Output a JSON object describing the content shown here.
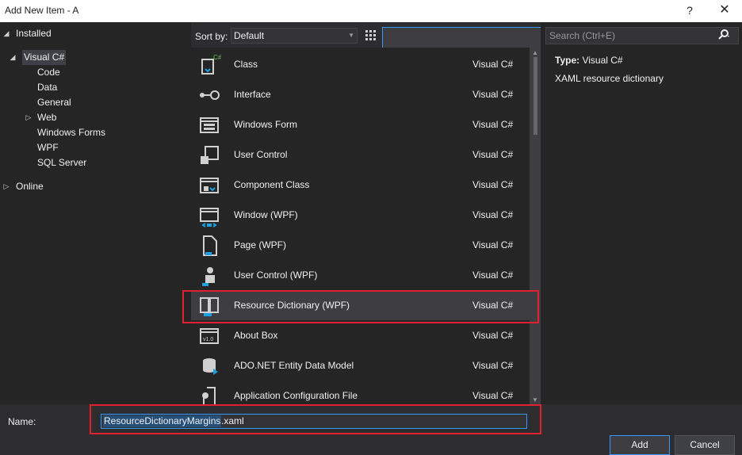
{
  "window": {
    "title": "Add New Item - A",
    "help_label": "?",
    "close_label": "✕"
  },
  "tree": {
    "installed": "Installed",
    "visual_csharp": "Visual C#",
    "children": [
      "Code",
      "Data",
      "General",
      "Web",
      "Windows Forms",
      "WPF",
      "SQL Server"
    ],
    "online": "Online"
  },
  "toolbar": {
    "sort_label": "Sort by:",
    "sort_value": "Default"
  },
  "search": {
    "placeholder": "Search (Ctrl+E)"
  },
  "items": [
    {
      "name": "Class",
      "type": "Visual C#",
      "icon": "class-icon"
    },
    {
      "name": "Interface",
      "type": "Visual C#",
      "icon": "interface-icon"
    },
    {
      "name": "Windows Form",
      "type": "Visual C#",
      "icon": "windows-form-icon"
    },
    {
      "name": "User Control",
      "type": "Visual C#",
      "icon": "user-control-icon"
    },
    {
      "name": "Component Class",
      "type": "Visual C#",
      "icon": "component-class-icon"
    },
    {
      "name": "Window (WPF)",
      "type": "Visual C#",
      "icon": "window-wpf-icon"
    },
    {
      "name": "Page (WPF)",
      "type": "Visual C#",
      "icon": "page-wpf-icon"
    },
    {
      "name": "User Control (WPF)",
      "type": "Visual C#",
      "icon": "user-control-wpf-icon"
    },
    {
      "name": "Resource Dictionary (WPF)",
      "type": "Visual C#",
      "icon": "resource-dictionary-icon"
    },
    {
      "name": "About Box",
      "type": "Visual C#",
      "icon": "about-box-icon"
    },
    {
      "name": "ADO.NET Entity Data Model",
      "type": "Visual C#",
      "icon": "entity-data-model-icon"
    },
    {
      "name": "Application Configuration File",
      "type": "Visual C#",
      "icon": "config-file-icon"
    }
  ],
  "selected_item": "Resource Dictionary (WPF)",
  "details": {
    "type_label": "Type:",
    "type_value": "Visual C#",
    "description": "XAML resource dictionary"
  },
  "footer": {
    "name_label": "Name:",
    "name_value_selected": "ResourceDictionaryMargins",
    "name_value_ext": ".xaml",
    "add_label": "Add",
    "cancel_label": "Cancel"
  },
  "colors": {
    "accent": "#3399ff",
    "highlight_box": "#e02030",
    "icon_blue": "#1ba1e2"
  }
}
